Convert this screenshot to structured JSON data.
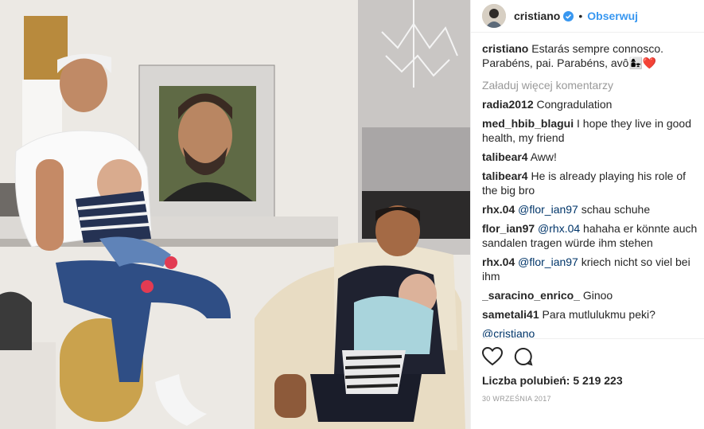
{
  "post": {
    "username": "cristiano",
    "follow_label": "Obserwuj",
    "caption_user": "cristiano",
    "caption_text": "Estarás sempre connosco. Parabéns, pai. Parabéns, avô👩‍👧❤️",
    "load_more": "Załaduj więcej komentarzy",
    "comments": [
      {
        "user": "radia2012",
        "mention": "",
        "text": "Congradulation"
      },
      {
        "user": "med_hbib_blagui",
        "mention": "",
        "text": "I hope they live in good health, my friend"
      },
      {
        "user": "talibear4",
        "mention": "",
        "text": "Aww!"
      },
      {
        "user": "talibear4",
        "mention": "",
        "text": "He is already playing his role of the big bro"
      },
      {
        "user": "rhx.04",
        "mention": "@flor_ian97",
        "text": "schau schuhe"
      },
      {
        "user": "flor_ian97",
        "mention": "@rhx.04",
        "text": "hahaha er könnte auch sandalen tragen würde ihm stehen"
      },
      {
        "user": "rhx.04",
        "mention": "@flor_ian97",
        "text": "kriech nicht so viel bei ihm"
      },
      {
        "user": "_saracino_enrico_",
        "mention": "",
        "text": "Ginoo"
      },
      {
        "user": "sametali41",
        "mention": "",
        "text": "Para mutlulukmu peki?"
      },
      {
        "user": "",
        "mention": "@cristiano",
        "text": ""
      }
    ],
    "likes_text": "Liczba polubień: 5 219 223",
    "date": "30 WRZEŚNIA 2017"
  },
  "icons": {
    "verified": "verified-badge-icon",
    "like": "heart-icon",
    "comment": "comment-bubble-icon"
  },
  "colors": {
    "link": "#3897f0",
    "mention": "#003569",
    "muted": "#999999"
  }
}
